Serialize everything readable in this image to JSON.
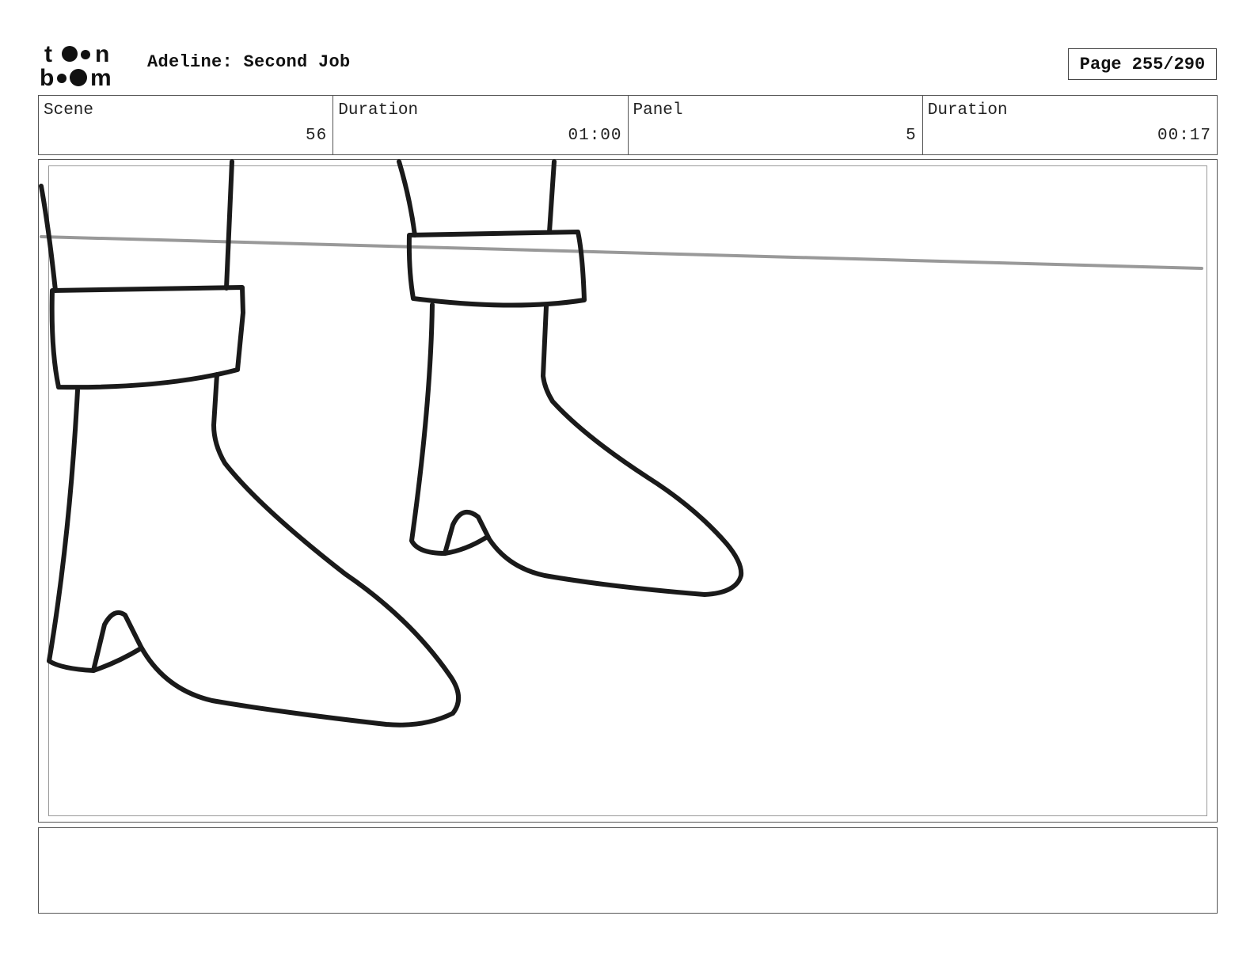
{
  "header": {
    "logo_text": "toon boom",
    "title": "Adeline: Second Job",
    "page_label": "Page 255/290"
  },
  "info": {
    "scene_label": "Scene",
    "scene_value": "56",
    "scene_duration_label": "Duration",
    "scene_duration_value": "01:00",
    "panel_label": "Panel",
    "panel_value": "5",
    "panel_duration_label": "Duration",
    "panel_duration_value": "00:17"
  },
  "panel": {
    "drawing": "boots-sketch"
  },
  "notes": {
    "text": ""
  }
}
